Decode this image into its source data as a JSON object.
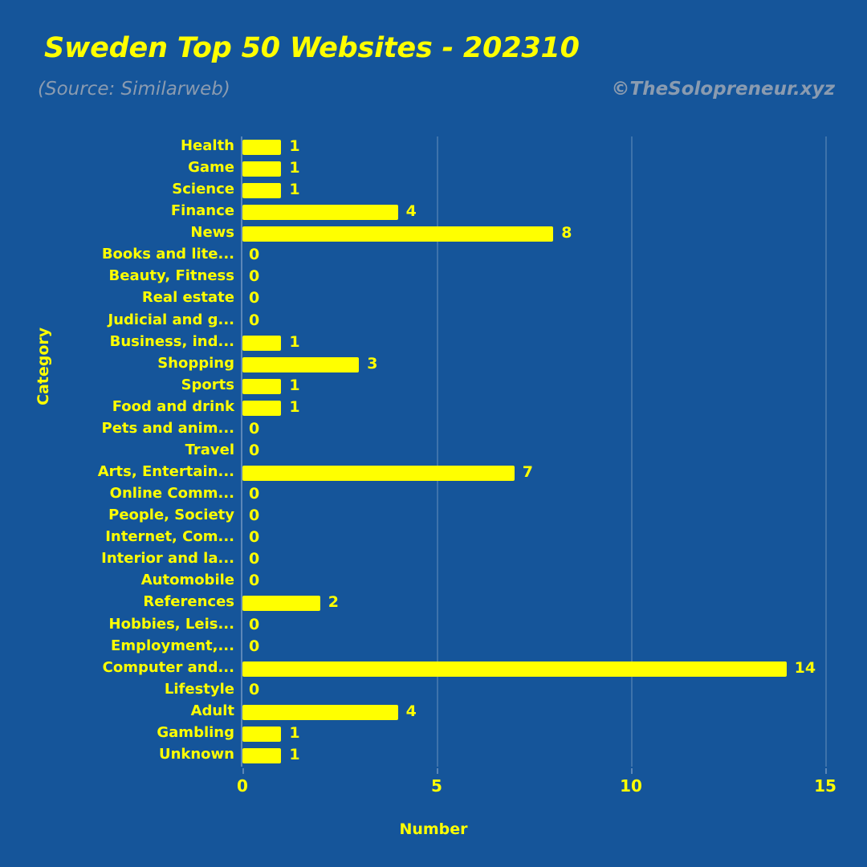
{
  "header": {
    "title": "Sweden Top 50 Websites - 202310",
    "subtitle": "(Source: Similarweb)",
    "watermark": "©TheSolopreneur.xyz"
  },
  "colors": {
    "background": "#15559A",
    "bar": "#FFFF00",
    "text": "#FFFF00",
    "muted": "#8A9BB0",
    "grid": "#3E73AB"
  },
  "chart_data": {
    "type": "bar",
    "orientation": "horizontal",
    "title": "Sweden Top 50 Websites - 202310",
    "subtitle": "(Source: Similarweb)",
    "xlabel": "Number",
    "ylabel": "Category",
    "xlim": [
      0,
      15
    ],
    "xticks": [
      0,
      5,
      10,
      15
    ],
    "xtick_labels": [
      "0",
      "5",
      "10",
      "15"
    ],
    "grid": true,
    "legend": false,
    "categories": [
      "Health",
      "Game",
      "Science",
      "Finance",
      "News",
      "Books and lite...",
      "Beauty, Fitness",
      "Real estate",
      "Judicial and g...",
      "Business, ind...",
      "Shopping",
      "Sports",
      "Food and drink",
      "Pets and anim...",
      "Travel",
      "Arts, Entertain...",
      "Online Comm...",
      "People, Society",
      "Internet, Com...",
      "Interior and la...",
      "Automobile",
      "References",
      "Hobbies, Leis...",
      "Employment,...",
      "Computer and...",
      "Lifestyle",
      "Adult",
      "Gambling",
      "Unknown"
    ],
    "values": [
      1,
      1,
      1,
      4,
      8,
      0,
      0,
      0,
      0,
      1,
      3,
      1,
      1,
      0,
      0,
      7,
      0,
      0,
      0,
      0,
      0,
      2,
      0,
      0,
      14,
      0,
      4,
      1,
      1
    ],
    "value_labels": [
      "1",
      "1",
      "1",
      "4",
      "8",
      "0",
      "0",
      "0",
      "0",
      "1",
      "3",
      "1",
      "1",
      "0",
      "0",
      "7",
      "0",
      "0",
      "0",
      "0",
      "0",
      "2",
      "0",
      "0",
      "14",
      "0",
      "4",
      "1",
      "1"
    ]
  }
}
